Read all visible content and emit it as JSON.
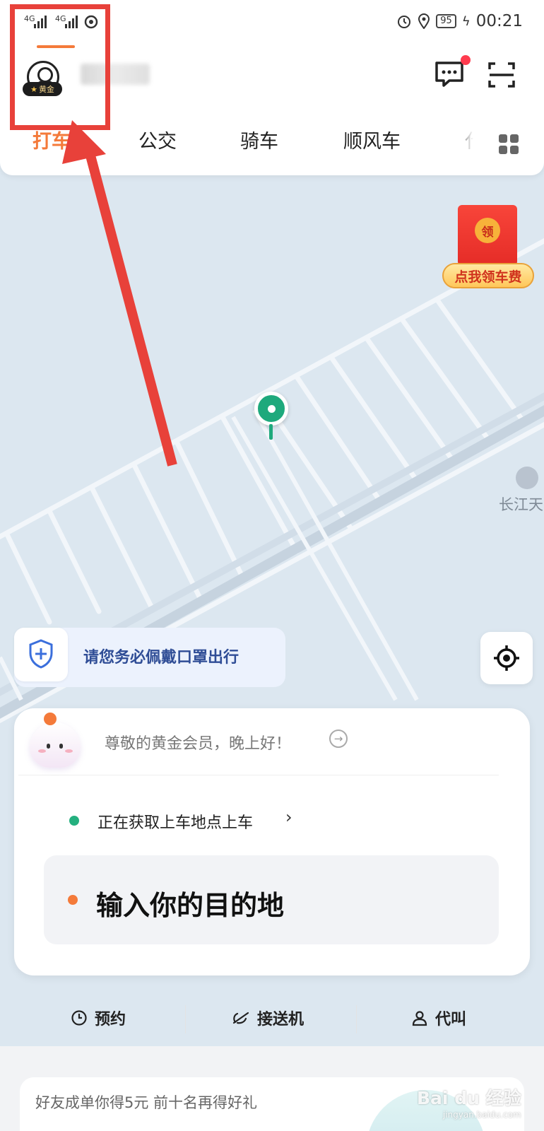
{
  "status_bar": {
    "signal_1": "4G",
    "signal_2": "4G",
    "battery": "95",
    "time": "00:21"
  },
  "header": {
    "member_badge": "黄金",
    "tabs": [
      {
        "label": "打车",
        "active": true
      },
      {
        "label": "公交",
        "active": false
      },
      {
        "label": "骑车",
        "active": false
      },
      {
        "label": "顺风车",
        "active": false
      },
      {
        "label": "代",
        "active": false
      }
    ]
  },
  "map": {
    "red_packet_coin": "领",
    "red_packet_label": "点我领车费",
    "poi_label": "长江天"
  },
  "mask_tip": {
    "text": "请您务必佩戴口罩出行"
  },
  "card": {
    "greeting": "尊敬的黄金会员，晚上好！",
    "pickup": "正在获取上车地点上车",
    "destination_placeholder": "输入你的目的地"
  },
  "actions": [
    {
      "label": "预约",
      "icon": "clock-icon"
    },
    {
      "label": "接送机",
      "icon": "airplane-icon"
    },
    {
      "label": "代叫",
      "icon": "person-icon"
    }
  ],
  "promo": {
    "text": "好友成单你得5元 前十名再得好礼"
  },
  "watermark": {
    "main": "Bai du 经验",
    "url": "jingyan.baidu.com"
  },
  "colors": {
    "accent": "#f47a3a",
    "pickup_green": "#24b07f",
    "annotation_red": "#e8413a",
    "mask_text_blue": "#2f4d96"
  }
}
